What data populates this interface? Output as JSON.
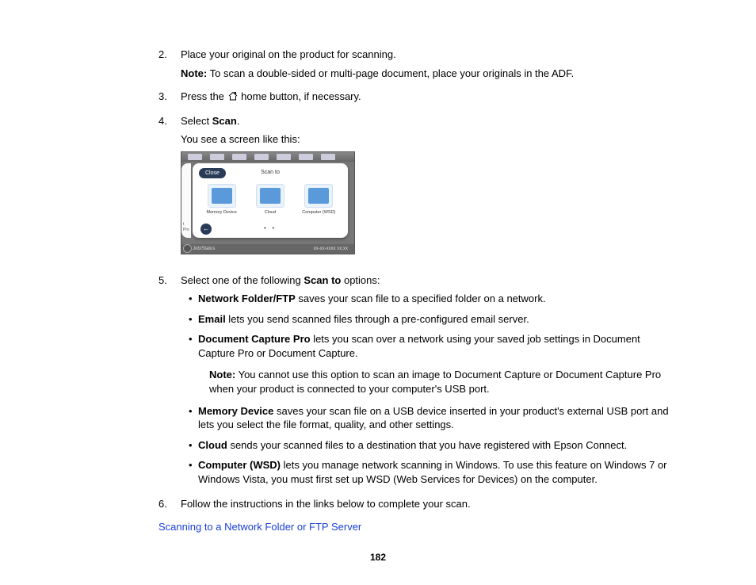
{
  "steps": {
    "s2": {
      "num": "2.",
      "text": "Place your original on the product for scanning."
    },
    "s2note": {
      "label": "Note:",
      "text": " To scan a double-sided or multi-page document, place your originals in the ADF."
    },
    "s3": {
      "num": "3.",
      "pre": "Press the ",
      "post": " home button, if necessary."
    },
    "s4": {
      "num": "4.",
      "pre": "Select ",
      "bold": "Scan",
      "post": ".",
      "after": "You see a screen like this:"
    },
    "s5": {
      "num": "5.",
      "pre": "Select one of the following ",
      "bold": "Scan to",
      "post": " options:"
    },
    "s6": {
      "num": "6.",
      "text": "Follow the instructions in the links below to complete your scan."
    }
  },
  "screenshot": {
    "close": "Close",
    "title": "Scan to",
    "icons": {
      "a": "Memory Device",
      "b": "Cloud",
      "c": "Computer (WSD)"
    },
    "left_label": "t\nPro",
    "job": "Job/Status",
    "date": "xx-xx-xxxx xx:xx"
  },
  "options": {
    "a": {
      "bold": "Network Folder/FTP",
      "text": " saves your scan file to a specified folder on a network."
    },
    "b": {
      "bold": "Email",
      "text": " lets you send scanned files through a pre-configured email server."
    },
    "c": {
      "bold": "Document Capture Pro",
      "text": " lets you scan over a network using your saved job settings in Document Capture Pro or Document Capture."
    },
    "cnote": {
      "label": "Note:",
      "text": " You cannot use this option to scan an image to Document Capture or Document Capture Pro when your product is connected to your computer's USB port."
    },
    "d": {
      "bold": "Memory Device",
      "text": " saves your scan file on a USB device inserted in your product's external USB port and lets you select the file format, quality, and other settings."
    },
    "e": {
      "bold": "Cloud",
      "text": " sends your scanned files to a destination that you have registered with Epson Connect."
    },
    "f": {
      "bold": "Computer (WSD)",
      "text": " lets you manage network scanning in Windows. To use this feature on Windows 7 or Windows Vista, you must first set up WSD (Web Services for Devices) on the computer."
    }
  },
  "link": "Scanning to a Network Folder or FTP Server",
  "page_number": "182"
}
